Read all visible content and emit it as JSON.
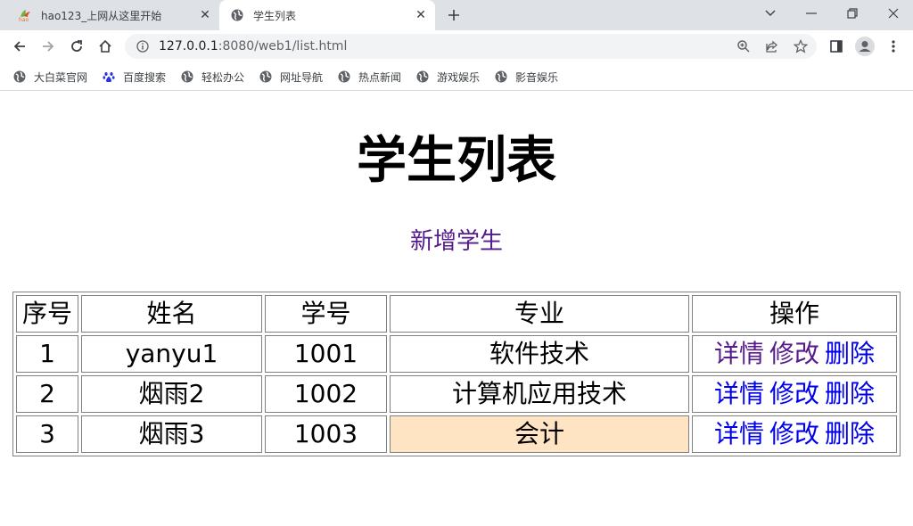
{
  "browser": {
    "tabs": [
      {
        "title": "hao123_上网从这里开始",
        "active": false
      },
      {
        "title": "学生列表",
        "active": true
      }
    ],
    "url_host": "127.0.0.1",
    "url_rest": ":8080/web1/list.html",
    "bookmarks": [
      {
        "label": "大白菜官网",
        "icon": "globe-icon"
      },
      {
        "label": "百度搜索",
        "icon": "baidu-paw-icon"
      },
      {
        "label": "轻松办公",
        "icon": "globe-icon"
      },
      {
        "label": "网址导航",
        "icon": "globe-icon"
      },
      {
        "label": "热点新闻",
        "icon": "globe-icon"
      },
      {
        "label": "游戏娱乐",
        "icon": "globe-icon"
      },
      {
        "label": "影音娱乐",
        "icon": "globe-icon"
      }
    ]
  },
  "page": {
    "title": "学生列表",
    "add_link": "新增学生",
    "table": {
      "headers": [
        "序号",
        "姓名",
        "学号",
        "专业",
        "操作"
      ],
      "rows": [
        {
          "index": "1",
          "name": "yanyu1",
          "id": "1001",
          "major": "软件技术",
          "highlight": false
        },
        {
          "index": "2",
          "name": "烟雨2",
          "id": "1002",
          "major": "计算机应用技术",
          "highlight": false
        },
        {
          "index": "3",
          "name": "烟雨3",
          "id": "1003",
          "major": "会计",
          "highlight": true
        }
      ],
      "actions": {
        "detail": "详情",
        "edit": "修改",
        "delete": "删除"
      }
    }
  },
  "colors": {
    "visited_link": "#551a8b",
    "unvisited_link": "#0000ee",
    "highlight_cell": "#ffe4c4",
    "tabstrip_bg": "#dee1e6"
  }
}
